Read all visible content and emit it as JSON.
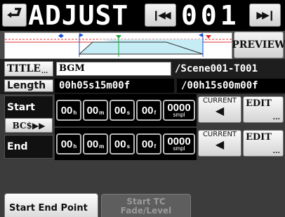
{
  "header": {
    "back_icon": "return-arrow-icon",
    "title": "ADJUST",
    "prev_icon": "skip-back-icon",
    "take_number": "001",
    "next_icon": "skip-forward-icon"
  },
  "fade_graph": {
    "preview_label": "PREVIEW",
    "markers": [
      "start-flag-icon",
      "fade-in-marker-icon",
      "level-marker-icon",
      "end-flag-icon",
      "fade-out-marker-icon"
    ]
  },
  "title_row": {
    "button_label": "TITLE",
    "button_dots": "...",
    "value": "BGM",
    "suffix": "/Scene001-T001"
  },
  "length_row": {
    "label": "Length",
    "value": "00h05s15m00f",
    "total": "/00h15s00m00f"
  },
  "start_row": {
    "label": "Start",
    "bcs_label": "BC$▶▶",
    "fields": [
      {
        "value": "00",
        "unit": "h"
      },
      {
        "value": "00",
        "unit": "m"
      },
      {
        "value": "00",
        "unit": "s"
      },
      {
        "value": "00",
        "unit": "f"
      },
      {
        "value": "0000",
        "unit": "smpl"
      }
    ],
    "current_label": "CURRENT",
    "edit_label": "EDIT",
    "edit_dots": "..."
  },
  "end_row": {
    "label": "End",
    "fields": [
      {
        "value": "00",
        "unit": "h"
      },
      {
        "value": "00",
        "unit": "m"
      },
      {
        "value": "00",
        "unit": "s"
      },
      {
        "value": "00",
        "unit": "f"
      },
      {
        "value": "0000",
        "unit": "smpl"
      }
    ],
    "current_label": "CURRENT",
    "edit_label": "EDIT",
    "edit_dots": "..."
  },
  "tabs": [
    {
      "label": "Start End Point",
      "active": true
    },
    {
      "label_line1": "Start TC",
      "label_line2": "Fade/Level",
      "active": false
    }
  ],
  "colors": {
    "start_marker": "#1a4fd8",
    "level_marker": "#1fa33a",
    "end_marker": "#e02020",
    "fade_fill": "#c6ecf6",
    "playhead_line": "#e03030"
  }
}
